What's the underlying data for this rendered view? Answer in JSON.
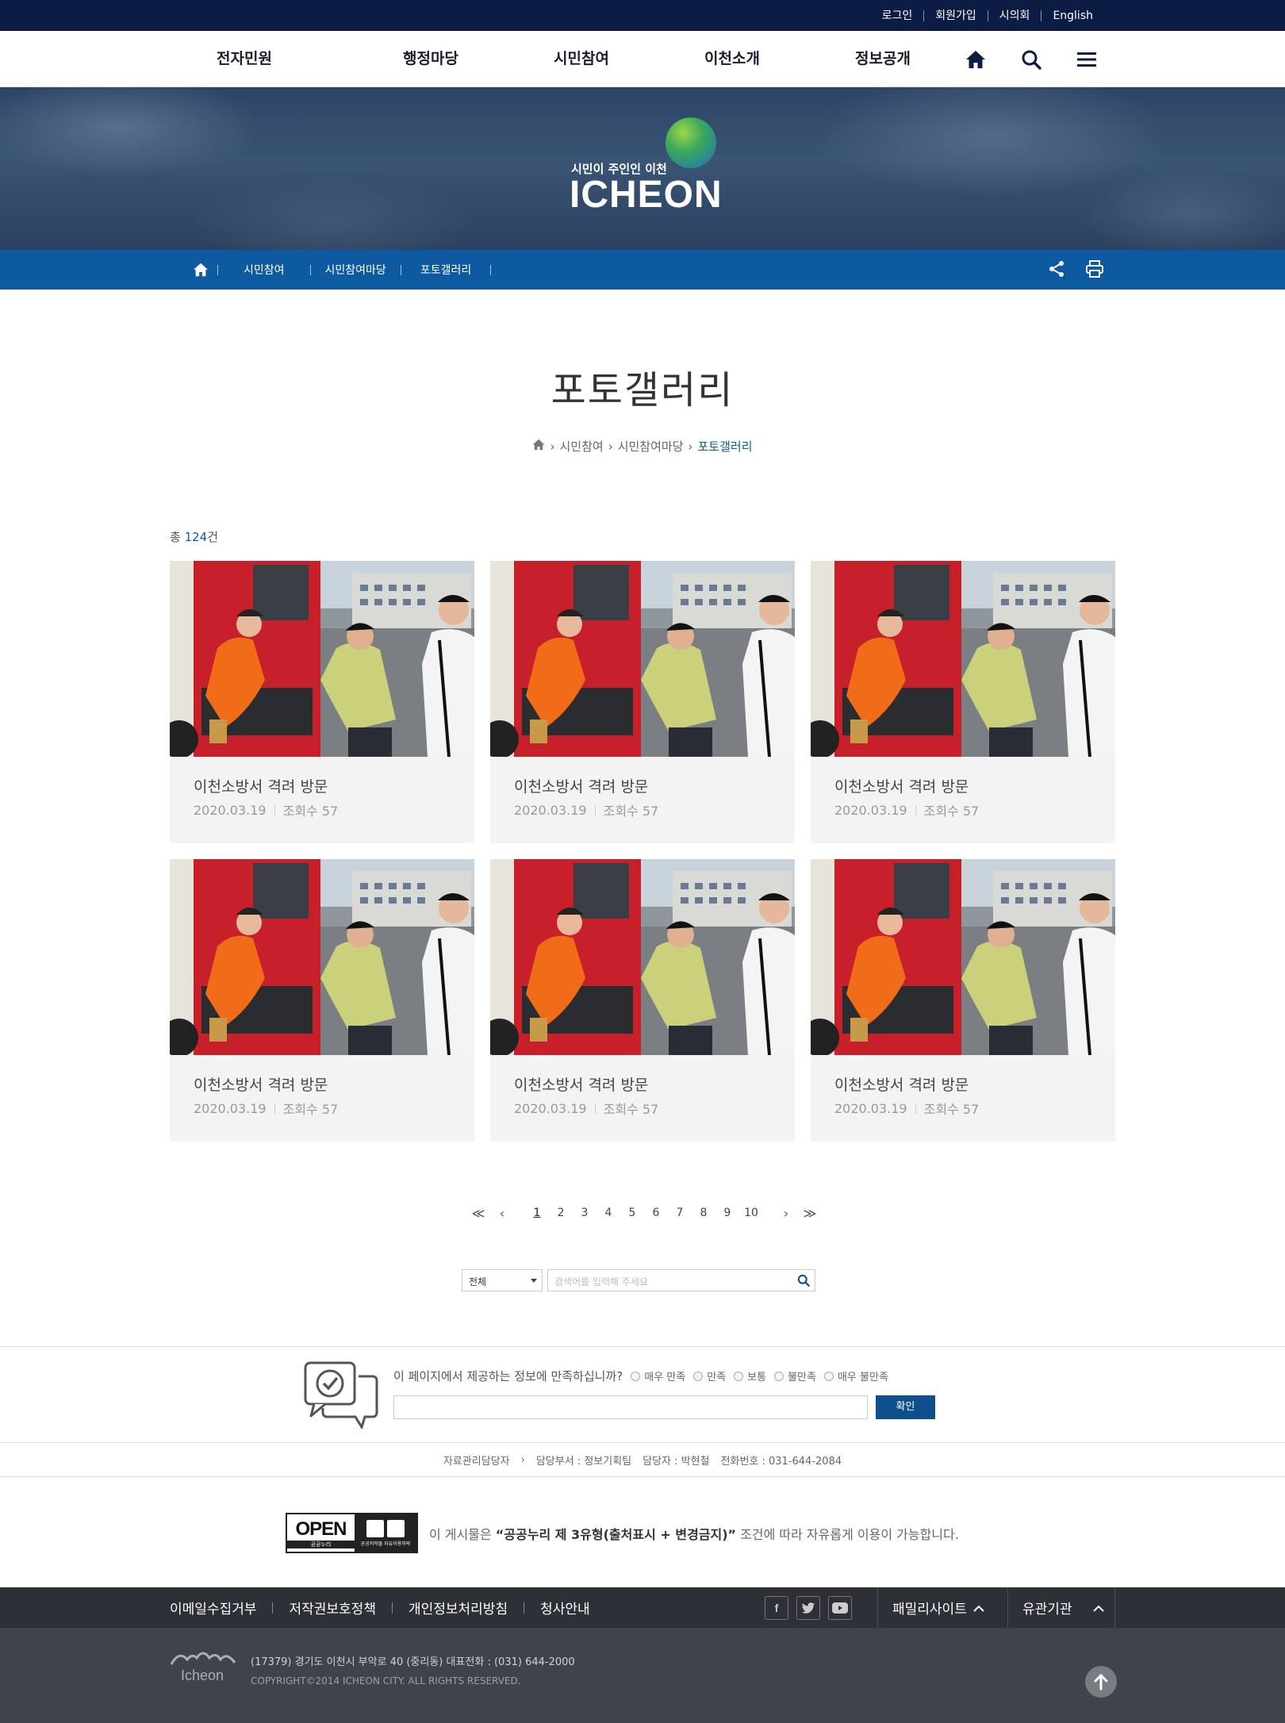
{
  "util": {
    "login": "로그인",
    "join": "회원가입",
    "council": "시의회",
    "english": "English"
  },
  "gnb": {
    "items": [
      "전자민원",
      "행정마당",
      "시민참여",
      "이천소개",
      "정보공개"
    ]
  },
  "banner": {
    "slogan": "시민이 주인인 이천",
    "brand": "ICHEON"
  },
  "location": {
    "items": [
      "시민참여",
      "시민참여마당",
      "포토갤러리"
    ]
  },
  "page": {
    "title": "포토갤러리",
    "path": [
      "시민참여",
      "시민참여마당",
      "포토갤러리"
    ],
    "count_prefix": "총 ",
    "count_value": "124",
    "count_suffix": "건"
  },
  "gallery": {
    "items": [
      {
        "title": "이천소방서 격려 방문",
        "date": "2020.03.19",
        "views": "조회수 57"
      },
      {
        "title": "이천소방서 격려 방문",
        "date": "2020.03.19",
        "views": "조회수 57"
      },
      {
        "title": "이천소방서 격려 방문",
        "date": "2020.03.19",
        "views": "조회수 57"
      },
      {
        "title": "이천소방서 격려 방문",
        "date": "2020.03.19",
        "views": "조회수 57"
      },
      {
        "title": "이천소방서 격려 방문",
        "date": "2020.03.19",
        "views": "조회수 57"
      },
      {
        "title": "이천소방서 격려 방문",
        "date": "2020.03.19",
        "views": "조회수 57"
      }
    ]
  },
  "pager": {
    "first": "≪",
    "prev": "‹",
    "next": "›",
    "last": "≫",
    "pages": [
      "1",
      "2",
      "3",
      "4",
      "5",
      "6",
      "7",
      "8",
      "9",
      "10"
    ],
    "current": "1"
  },
  "search": {
    "select_value": "전체",
    "placeholder": "검색어를 입력해 주세요"
  },
  "satisfaction": {
    "question": "이 페이지에서 제공하는 정보에 만족하십니까?",
    "options": [
      "매우 만족",
      "만족",
      "보통",
      "불만족",
      "매우 불만족"
    ],
    "submit": "확인"
  },
  "manager": {
    "label": "자료관리담당자",
    "dept": "담당부서 : 정보기획팀",
    "person": "담당자 : 박현철",
    "phone": "전화번호 : 031-644-2084"
  },
  "license": {
    "badge_main": "OPEN",
    "badge_sub": "공공누리",
    "badge_right": "공공저작물 자유이용허락",
    "text_before": "이 게시물은 ",
    "text_bold": "“공공누리 제 3유형(출처표시 + 변경금지)”",
    "text_after": " 조건에 따라 자유롭게 이용이 가능합니다."
  },
  "footer": {
    "links": [
      "이메일수집거부",
      "저작권보호정책",
      "개인정보처리방침",
      "청사안내"
    ],
    "family": "패밀리사이트",
    "related": "유관기관",
    "address": "(17379) 경기도 이천시 부악로 40 (중리동) 대표전화 : (031) 644-2000",
    "copyright": "COPYRIGHT©2014 ICHEON CITY. ALL RIGHTS RESERVED.",
    "logo_text": "Icheon"
  },
  "colors": {
    "navy": "#0c1c44",
    "blue": "#0e5aa1",
    "footer_dark": "#2d3036",
    "footer_mid": "#3f434a"
  }
}
